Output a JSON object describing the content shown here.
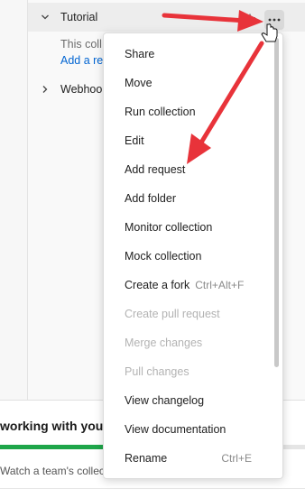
{
  "collections": {
    "tutorial": {
      "name": "Tutorial",
      "description_partial": "This coll",
      "link_partial": "Add a re"
    },
    "webhook": {
      "name": "Webhoo"
    }
  },
  "promo": {
    "title": "working with your",
    "subtitle": "Watch a team's collec",
    "progress": 0.35,
    "progress_color": "#1ea64a"
  },
  "menu": {
    "items": [
      {
        "label": "Share",
        "shortcut": "",
        "enabled": true
      },
      {
        "label": "Move",
        "shortcut": "",
        "enabled": true
      },
      {
        "label": "Run collection",
        "shortcut": "",
        "enabled": true
      },
      {
        "label": "Edit",
        "shortcut": "",
        "enabled": true
      },
      {
        "label": "Add request",
        "shortcut": "",
        "enabled": true
      },
      {
        "label": "Add folder",
        "shortcut": "",
        "enabled": true
      },
      {
        "label": "Monitor collection",
        "shortcut": "",
        "enabled": true
      },
      {
        "label": "Mock collection",
        "shortcut": "",
        "enabled": true
      },
      {
        "label": "Create a fork",
        "shortcut": "Ctrl+Alt+F",
        "enabled": true
      },
      {
        "label": "Create pull request",
        "shortcut": "",
        "enabled": false
      },
      {
        "label": "Merge changes",
        "shortcut": "",
        "enabled": false
      },
      {
        "label": "Pull changes",
        "shortcut": "",
        "enabled": false
      },
      {
        "label": "View changelog",
        "shortcut": "",
        "enabled": true
      },
      {
        "label": "View documentation",
        "shortcut": "",
        "enabled": true
      },
      {
        "label": "Rename",
        "shortcut": "Ctrl+E",
        "enabled": true
      }
    ]
  },
  "icons": {
    "more": "more-horizontal-icon",
    "star": "star-icon",
    "chevron_down": "chevron-down-icon",
    "chevron_right": "chevron-right-icon",
    "cursor": "hand-pointer-icon"
  },
  "colors": {
    "annotation_arrow": "#e8333a",
    "link": "#0265d2",
    "disabled_text": "#b3b3b3"
  }
}
